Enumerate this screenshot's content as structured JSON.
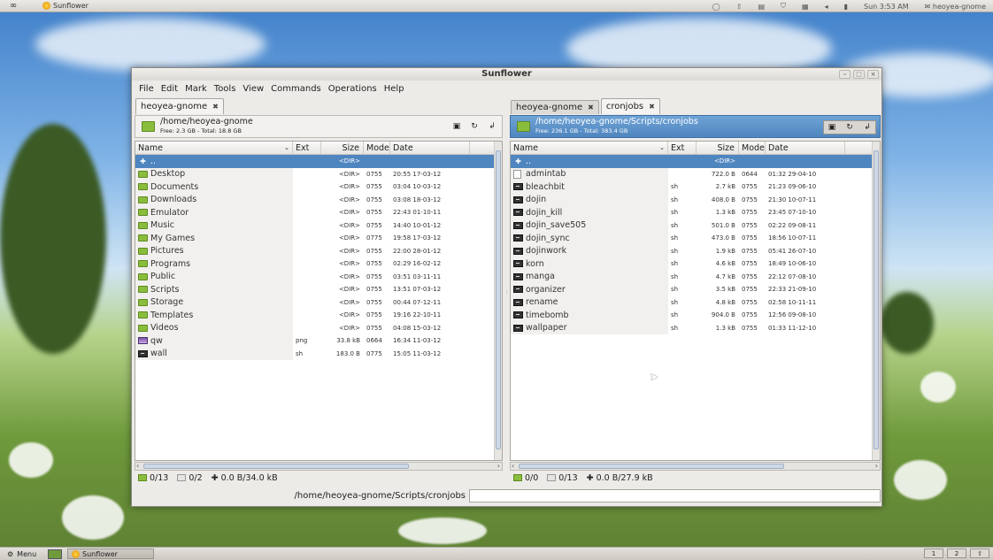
{
  "top_panel": {
    "launcher": "∞",
    "app_label": "Sunflower",
    "clock": "Sun  3:53 AM",
    "user": "heoyea-gnome"
  },
  "bottom_panel": {
    "menu_label": "Menu",
    "task_label": "Sunflower",
    "workspaces": [
      "1",
      "2"
    ]
  },
  "window": {
    "title": "Sunflower",
    "menu": [
      "File",
      "Edit",
      "Mark",
      "Tools",
      "View",
      "Commands",
      "Operations",
      "Help"
    ],
    "columns": {
      "name": "Name",
      "ext": "Ext",
      "size": "Size",
      "mode": "Mode",
      "date": "Date"
    },
    "updir": {
      "name": "..",
      "size": "<DIR>"
    },
    "command_cwd": "/home/heoyea-gnome/Scripts/cronjobs",
    "command_value": ""
  },
  "left_pane": {
    "tabs": [
      {
        "label": "heoyea-gnome",
        "close": "✖"
      }
    ],
    "path": "/home/heoyea-gnome",
    "free": "Free: 2.3 GB - Total: 18.8 GB",
    "rows": [
      {
        "icon": "folder",
        "name": "Desktop",
        "ext": "",
        "size": "<DIR>",
        "mode": "0755",
        "date": "20:55 17-03-12"
      },
      {
        "icon": "folder",
        "name": "Documents",
        "ext": "",
        "size": "<DIR>",
        "mode": "0755",
        "date": "03:04 10-03-12"
      },
      {
        "icon": "folder",
        "name": "Downloads",
        "ext": "",
        "size": "<DIR>",
        "mode": "0755",
        "date": "03:08 18-03-12"
      },
      {
        "icon": "folder",
        "name": "Emulator",
        "ext": "",
        "size": "<DIR>",
        "mode": "0755",
        "date": "22:43 01-10-11"
      },
      {
        "icon": "folder",
        "name": "Music",
        "ext": "",
        "size": "<DIR>",
        "mode": "0755",
        "date": "14:40 10-01-12"
      },
      {
        "icon": "folder",
        "name": "My Games",
        "ext": "",
        "size": "<DIR>",
        "mode": "0775",
        "date": "19:58 17-03-12"
      },
      {
        "icon": "folder",
        "name": "Pictures",
        "ext": "",
        "size": "<DIR>",
        "mode": "0755",
        "date": "22:00 28-01-12"
      },
      {
        "icon": "folder",
        "name": "Programs",
        "ext": "",
        "size": "<DIR>",
        "mode": "0755",
        "date": "02:29 16-02-12"
      },
      {
        "icon": "folder",
        "name": "Public",
        "ext": "",
        "size": "<DIR>",
        "mode": "0755",
        "date": "03:51 03-11-11"
      },
      {
        "icon": "folder",
        "name": "Scripts",
        "ext": "",
        "size": "<DIR>",
        "mode": "0755",
        "date": "13:51 07-03-12"
      },
      {
        "icon": "folder",
        "name": "Storage",
        "ext": "",
        "size": "<DIR>",
        "mode": "0755",
        "date": "00:44 07-12-11"
      },
      {
        "icon": "folder",
        "name": "Templates",
        "ext": "",
        "size": "<DIR>",
        "mode": "0755",
        "date": "19:16 22-10-11"
      },
      {
        "icon": "folder",
        "name": "Videos",
        "ext": "",
        "size": "<DIR>",
        "mode": "0755",
        "date": "04:08 15-03-12"
      },
      {
        "icon": "image",
        "name": "qw",
        "ext": "png",
        "size": "33.8 kB",
        "mode": "0664",
        "date": "16:34 11-03-12"
      },
      {
        "icon": "script",
        "name": "wall",
        "ext": "sh",
        "size": "183.0 B",
        "mode": "0775",
        "date": "15:05 11-03-12"
      }
    ],
    "status": {
      "dirs": "0/13",
      "files": "0/2",
      "size": "0.0 B/34.0 kB"
    }
  },
  "right_pane": {
    "tabs": [
      {
        "label": "heoyea-gnome",
        "close": "✖"
      },
      {
        "label": "cronjobs",
        "close": "✖"
      }
    ],
    "path": "/home/heoyea-gnome/Scripts/cronjobs",
    "free": "Free: 236.1 GB - Total: 383.4 GB",
    "rows": [
      {
        "icon": "file",
        "name": "admintab",
        "ext": "",
        "size": "722.0 B",
        "mode": "0644",
        "date": "01:32 29-04-10"
      },
      {
        "icon": "script",
        "name": "bleachbit",
        "ext": "sh",
        "size": "2.7 kB",
        "mode": "0755",
        "date": "21:23 09-06-10"
      },
      {
        "icon": "script",
        "name": "dojin",
        "ext": "sh",
        "size": "408.0 B",
        "mode": "0755",
        "date": "21:30 10-07-11"
      },
      {
        "icon": "script",
        "name": "dojin_kill",
        "ext": "sh",
        "size": "1.3 kB",
        "mode": "0755",
        "date": "23:45 07-10-10"
      },
      {
        "icon": "script",
        "name": "dojin_save505",
        "ext": "sh",
        "size": "501.0 B",
        "mode": "0755",
        "date": "02:22 09-08-11"
      },
      {
        "icon": "script",
        "name": "dojin_sync",
        "ext": "sh",
        "size": "473.0 B",
        "mode": "0755",
        "date": "18:56 10-07-11"
      },
      {
        "icon": "script",
        "name": "dojinwork",
        "ext": "sh",
        "size": "1.9 kB",
        "mode": "0755",
        "date": "05:41 26-07-10"
      },
      {
        "icon": "script",
        "name": "korn",
        "ext": "sh",
        "size": "4.6 kB",
        "mode": "0755",
        "date": "18:49 10-06-10"
      },
      {
        "icon": "script",
        "name": "manga",
        "ext": "sh",
        "size": "4.7 kB",
        "mode": "0755",
        "date": "22:12 07-08-10"
      },
      {
        "icon": "script",
        "name": "organizer",
        "ext": "sh",
        "size": "3.5 kB",
        "mode": "0755",
        "date": "22:33 21-09-10"
      },
      {
        "icon": "script",
        "name": "rename",
        "ext": "sh",
        "size": "4.8 kB",
        "mode": "0755",
        "date": "02:58 10-11-11"
      },
      {
        "icon": "script",
        "name": "timebomb",
        "ext": "sh",
        "size": "904.0 B",
        "mode": "0755",
        "date": "12:56 09-08-10"
      },
      {
        "icon": "script",
        "name": "wallpaper",
        "ext": "sh",
        "size": "1.3 kB",
        "mode": "0755",
        "date": "01:33 11-12-10"
      }
    ],
    "status": {
      "dirs": "0/0",
      "files": "0/13",
      "size": "0.0 B/27.9 kB"
    }
  }
}
